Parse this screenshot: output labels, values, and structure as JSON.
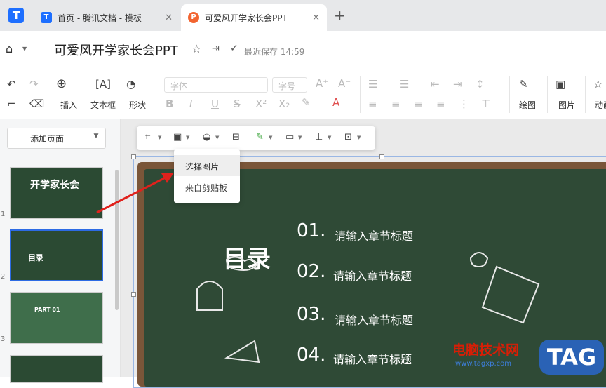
{
  "tabs": [
    {
      "title": "首页 - 腾讯文档 - 模板",
      "close": "✕"
    },
    {
      "title": "可爱风开学家长会PPT",
      "close": "✕"
    }
  ],
  "new_tab": "+",
  "doc": {
    "title": "可爱风开学家长会PPT",
    "save_status": "最近保存 14:59"
  },
  "toolbar": {
    "insert_label": "插入",
    "textbox_label": "文本框",
    "shape_label": "形状",
    "font_placeholder": "字体",
    "size_placeholder": "字号",
    "draw_label": "绘图",
    "image_label": "图片",
    "anim_label": "动画"
  },
  "sidebar": {
    "add_page": "添加页面",
    "thumbs": [
      {
        "num": "1",
        "text": "开学家长会"
      },
      {
        "num": "2",
        "text": "目录"
      },
      {
        "num": "3",
        "text": "PART 01"
      }
    ]
  },
  "image_menu": {
    "items": [
      "选择图片",
      "来自剪贴板"
    ]
  },
  "slide": {
    "heading": "目录",
    "sections": [
      {
        "num": "01.",
        "title": "请输入章节标题"
      },
      {
        "num": "02.",
        "title": "请输入章节标题"
      },
      {
        "num": "03.",
        "title": "请输入章节标题"
      },
      {
        "num": "04.",
        "title": "请输入章节标题"
      }
    ]
  },
  "watermark": {
    "site": "电脑技术网",
    "url": "www.tagxp.com",
    "tag": "TAG"
  },
  "colors": {
    "board": "#2f4a36",
    "frame": "#7a5639",
    "accent": "#2d6be4",
    "arrow": "#e0211c"
  }
}
